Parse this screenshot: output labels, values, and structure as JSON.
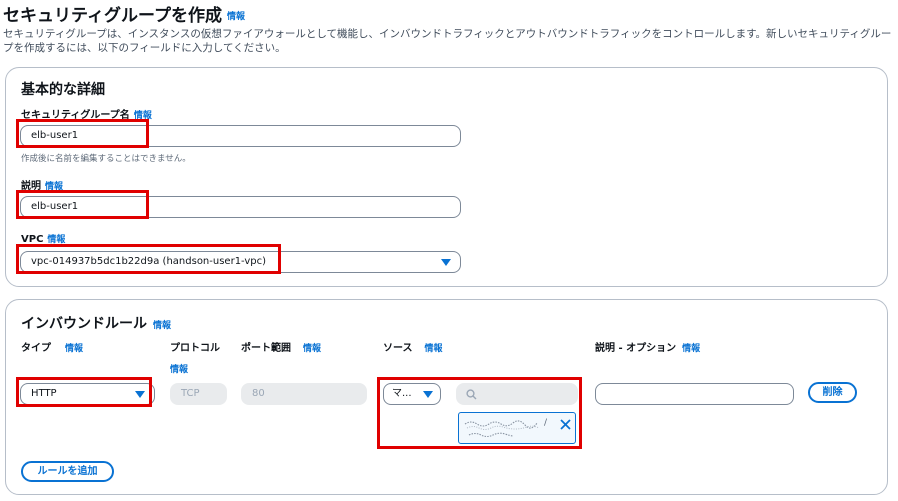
{
  "header": {
    "title": "セキュリティグループを作成",
    "info_link": "情報",
    "description": "セキュリティグループは、インスタンスの仮想ファイアウォールとして機能し、インバウンドトラフィックとアウトバウンドトラフィックをコントロールします。新しいセキュリティグループを作成するには、以下のフィールドに入力してください。"
  },
  "basic_details": {
    "title": "基本的な詳細",
    "name_label": "セキュリティグループ名",
    "name_info": "情報",
    "name_value": "elb-user1",
    "name_hint": "作成後に名前を編集することはできません。",
    "desc_label": "説明",
    "desc_info": "情報",
    "desc_value": "elb-user1",
    "vpc_label": "VPC",
    "vpc_info": "情報",
    "vpc_value": "vpc-014937b5dc1b22d9a (handson-user1-vpc)"
  },
  "inbound": {
    "title": "インバウンドルール",
    "info": "情報",
    "col_type": "タイプ",
    "col_type_info": "情報",
    "col_protocol": "プロトコル",
    "col_protocol_info": "情報",
    "col_port": "ポート範囲",
    "col_port_info": "情報",
    "col_source": "ソース",
    "col_source_info": "情報",
    "col_desc": "説明 - オプション",
    "col_desc_info": "情報",
    "rule": {
      "type": "HTTP",
      "protocol": "TCP",
      "port": "80",
      "source_type": "マ...",
      "source_token": "/"
    },
    "delete_button": "削除",
    "add_rule_button": "ルールを追加"
  },
  "colors": {
    "accent": "#0972d3",
    "highlight": "#e00000",
    "border": "#b6bec9"
  }
}
